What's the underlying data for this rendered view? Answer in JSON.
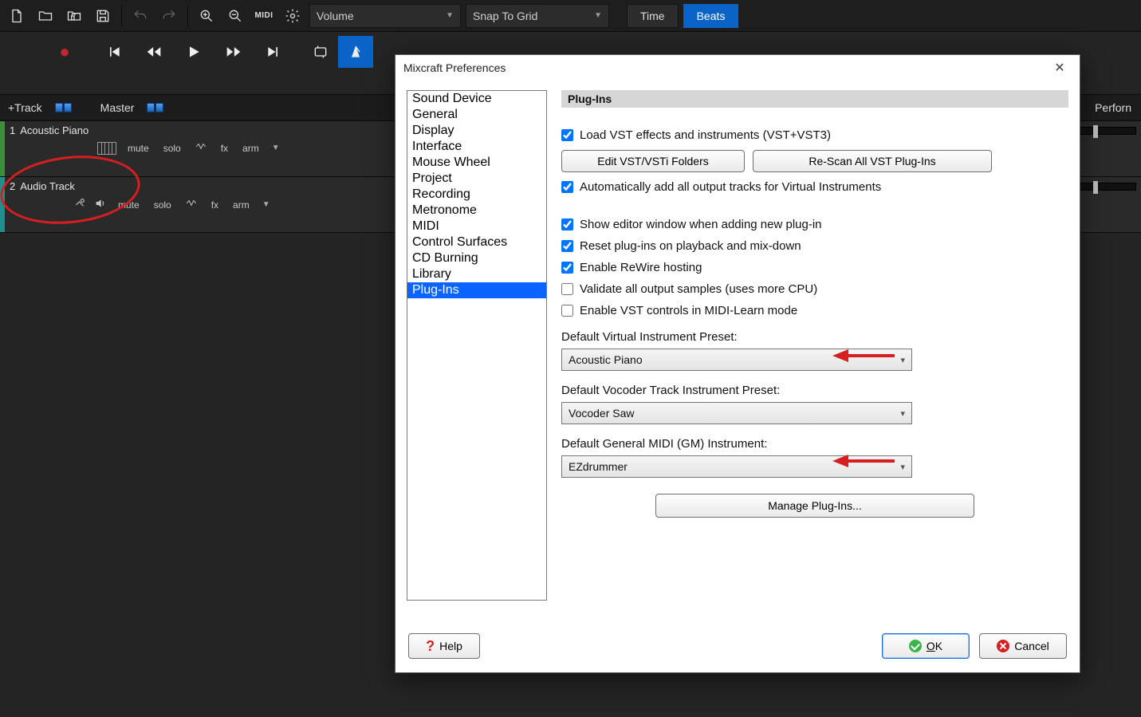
{
  "toolbar": {
    "volume_dropdown": "Volume",
    "snap_dropdown": "Snap To Grid",
    "time_label": "Time",
    "beats_label": "Beats"
  },
  "track_header": {
    "add_track": "+Track",
    "master": "Master",
    "perform": "Perforn"
  },
  "tracks": [
    {
      "num": "1",
      "name": "Acoustic Piano",
      "color": "#3a8f3a",
      "mute": "mute",
      "solo": "solo",
      "fx": "fx",
      "arm": "arm"
    },
    {
      "num": "2",
      "name": "Audio Track",
      "color": "#1f8f8f",
      "mute": "mute",
      "solo": "solo",
      "fx": "fx",
      "arm": "arm"
    }
  ],
  "prefs": {
    "title": "Mixcraft Preferences",
    "nav": [
      "Sound Device",
      "General",
      "Display",
      "Interface",
      "Mouse Wheel",
      "Project",
      "Recording",
      "Metronome",
      "MIDI",
      "Control Surfaces",
      "CD Burning",
      "Library",
      "Plug-Ins"
    ],
    "nav_selected": "Plug-Ins",
    "section_header": "Plug-Ins",
    "load_vst_label": "Load VST effects and instruments (VST+VST3)",
    "edit_folders_btn": "Edit VST/VSTi Folders",
    "rescan_btn": "Re-Scan All VST Plug-Ins",
    "auto_add_outputs_label": "Automatically add all output tracks for Virtual Instruments",
    "show_editor_label": "Show editor window when adding new plug-in",
    "reset_plugins_label": "Reset plug-ins on playback and mix-down",
    "enable_rewire_label": "Enable ReWire hosting",
    "validate_samples_label": "Validate all output samples (uses more CPU)",
    "vst_midi_learn_label": "Enable VST controls in MIDI-Learn mode",
    "default_vi_label": "Default Virtual Instrument Preset:",
    "default_vi_value": "Acoustic Piano",
    "default_vocoder_label": "Default Vocoder Track Instrument Preset:",
    "default_vocoder_value": "Vocoder Saw",
    "default_gm_label": "Default General MIDI (GM) Instrument:",
    "default_gm_value": "EZdrummer",
    "manage_btn": "Manage Plug-Ins...",
    "help_btn": "Help",
    "ok_btn": "OK",
    "cancel_btn": "Cancel"
  }
}
